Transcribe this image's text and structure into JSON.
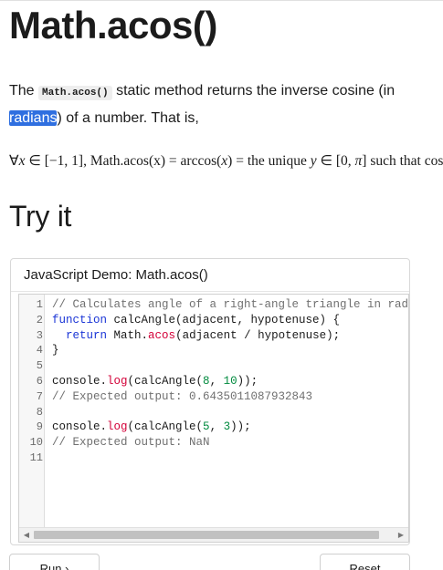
{
  "page": {
    "title": "Math.acos()",
    "intro": {
      "prefix": "The ",
      "code": "Math.acos()",
      "middle": " static method returns the inverse cosine (in ",
      "link": "radians",
      "suffix": ") of a number. That is,"
    },
    "formula": {
      "forall": "∀",
      "x1": "x",
      "in1": " ∈ [−1, 1],  Math.acos",
      "arg": "(x)",
      "eq1": " = arccos(",
      "x2": "x",
      "eq2": ") = the unique ",
      "y": "y",
      "in2": " ∈ [0, ",
      "pi": "π",
      "tail": "] such that cos(y) = x"
    },
    "section_title": "Try it"
  },
  "demo": {
    "header": "JavaScript Demo: Math.acos()",
    "lines": [
      {
        "num": "1",
        "segments": [
          {
            "t": "// Calculates angle of a right-angle triangle in radians",
            "c": "comment"
          }
        ]
      },
      {
        "num": "2",
        "segments": [
          {
            "t": "function",
            "c": "kw"
          },
          {
            "t": " calcAngle(adjacent, hypotenuse) {",
            "c": ""
          }
        ]
      },
      {
        "num": "3",
        "segments": [
          {
            "t": "  ",
            "c": ""
          },
          {
            "t": "return",
            "c": "kw"
          },
          {
            "t": " Math.",
            "c": ""
          },
          {
            "t": "acos",
            "c": "method"
          },
          {
            "t": "(adjacent / hypotenuse);",
            "c": ""
          }
        ]
      },
      {
        "num": "4",
        "segments": [
          {
            "t": "}",
            "c": ""
          }
        ]
      },
      {
        "num": "5",
        "segments": []
      },
      {
        "num": "6",
        "segments": [
          {
            "t": "console.",
            "c": ""
          },
          {
            "t": "log",
            "c": "method"
          },
          {
            "t": "(calcAngle(",
            "c": ""
          },
          {
            "t": "8",
            "c": "num"
          },
          {
            "t": ", ",
            "c": ""
          },
          {
            "t": "10",
            "c": "num"
          },
          {
            "t": "));",
            "c": ""
          }
        ]
      },
      {
        "num": "7",
        "segments": [
          {
            "t": "// Expected output: 0.6435011087932843",
            "c": "comment"
          }
        ]
      },
      {
        "num": "8",
        "segments": []
      },
      {
        "num": "9",
        "segments": [
          {
            "t": "console.",
            "c": ""
          },
          {
            "t": "log",
            "c": "method"
          },
          {
            "t": "(calcAngle(",
            "c": ""
          },
          {
            "t": "5",
            "c": "num"
          },
          {
            "t": ", ",
            "c": ""
          },
          {
            "t": "3",
            "c": "num"
          },
          {
            "t": "));",
            "c": ""
          }
        ]
      },
      {
        "num": "10",
        "segments": [
          {
            "t": "// Expected output: NaN",
            "c": "comment"
          }
        ]
      },
      {
        "num": "11",
        "segments": []
      }
    ],
    "scroll_left_icon": "triangle-left-icon",
    "scroll_right_icon": "triangle-right-icon",
    "run_label": "Run ›",
    "reset_label": "Reset"
  },
  "colors": {
    "selection": "#2f6fe0",
    "keyword": "#1a35d6",
    "method": "#d30038",
    "number": "#008a3e",
    "comment": "#707070"
  }
}
